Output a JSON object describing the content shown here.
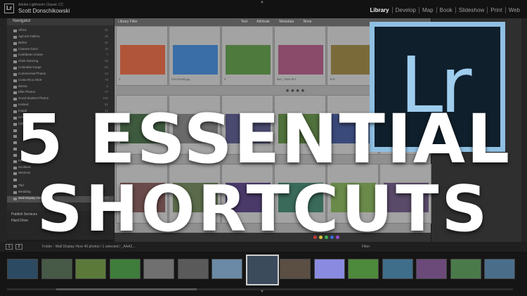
{
  "window": {
    "app_title": "Adobe Lightroom Classic CC",
    "user_name": "Scott Donschikowski",
    "logo_text": "Lr"
  },
  "modules": [
    "Library",
    "Develop",
    "Map",
    "Book",
    "Slideshow",
    "Print",
    "Web"
  ],
  "active_module": "Library",
  "left_panel": {
    "header": "Navigator",
    "folders": [
      {
        "name": "Africa",
        "count": "41"
      },
      {
        "name": "AgCoat Gallery",
        "count": "46"
      },
      {
        "name": "Belize",
        "count": "41"
      },
      {
        "name": "Camera Gunz",
        "count": "14"
      },
      {
        "name": "Caribbean Cruise",
        "count": "7"
      },
      {
        "name": "Clark Dancing",
        "count": "40"
      },
      {
        "name": "Columbia Gorge",
        "count": "64"
      },
      {
        "name": "Commercial Photos",
        "count": "14"
      },
      {
        "name": "Costa Rica 2019",
        "count": "73"
      },
      {
        "name": "donna",
        "count": "5"
      },
      {
        "name": "Elite Photos",
        "count": "47"
      },
      {
        "name": "Good Student Photos",
        "count": "152"
      },
      {
        "name": "Iceland",
        "count": "51"
      },
      {
        "name": "Install",
        "count": "42"
      },
      {
        "name": "instagram",
        "count": "1"
      },
      {
        "name": "Lightroom",
        "count": "9"
      },
      {
        "name": "",
        "count": ""
      },
      {
        "name": "",
        "count": ""
      },
      {
        "name": "",
        "count": ""
      },
      {
        "name": "",
        "count": ""
      },
      {
        "name": "",
        "count": ""
      },
      {
        "name": "Retirement Visu",
        "count": ""
      },
      {
        "name": "Scotland",
        "count": ""
      },
      {
        "name": "Services",
        "count": ""
      },
      {
        "name": "",
        "count": ""
      },
      {
        "name": "Tbd",
        "count": ""
      },
      {
        "name": "Wedding",
        "count": ""
      },
      {
        "name": "Wall Display Here",
        "count": "44"
      }
    ],
    "footer": {
      "section": "Publish Services",
      "drive": "Hard Drive"
    }
  },
  "library_filter": {
    "title": "Library Filter",
    "options": [
      "Text",
      "Attribute",
      "Metadata",
      "None"
    ]
  },
  "grid": {
    "row1_meta": [
      "0",
      "DSC05158.jpg",
      "3",
      "IMG_7658.JPG",
      "JPG",
      "1",
      "L1010557.JPG",
      "1",
      "DSC_1254"
    ],
    "rating_stars": "★★★★",
    "cell_label": "IMG_3022.JPG"
  },
  "headline": {
    "line1": "5 ESSENTIAL",
    "line2": "SHORTCUTS"
  },
  "filmstrip": {
    "pages": [
      "1",
      "2"
    ],
    "info": "Folder - Wall Display Here   46 photos / 1 selected / _AAA2...",
    "filter_label": "Filter",
    "thumb_colors": [
      "#2d4a63",
      "#465a47",
      "#5b7a3a",
      "#3f7d3c",
      "#707070",
      "#5a5a5a",
      "#6a8aa6",
      "#3c4b5c",
      "#5b4e43",
      "#8a8ae0",
      "#4e8a3b",
      "#3e6e8a",
      "#6b4a7a",
      "#4a7a4a",
      "#4a6e8a"
    ]
  },
  "colors": {
    "logo_border": "#8fc0e3",
    "logo_bg": "#0f1f2b",
    "headline": "#ffffff"
  }
}
